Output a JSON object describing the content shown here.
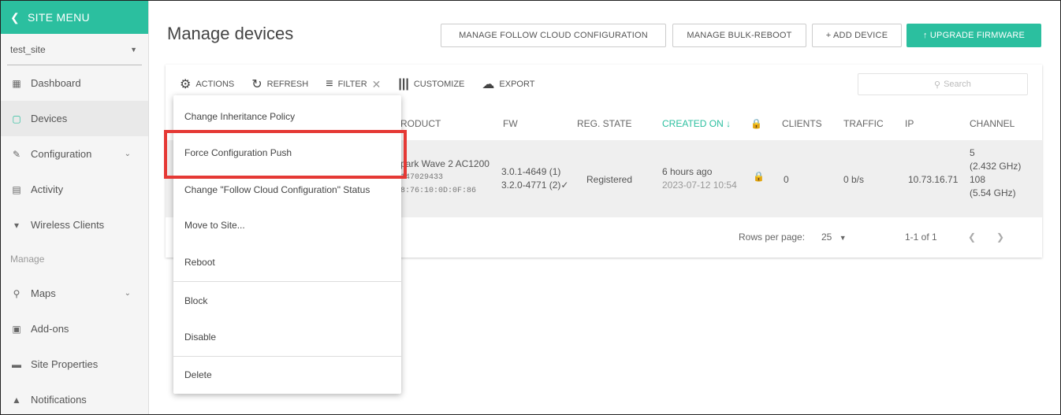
{
  "sidebar": {
    "header": "SITE MENU",
    "site": "test_site",
    "items": [
      {
        "label": "Dashboard",
        "icon": "dashboard-icon",
        "glyph": "▦"
      },
      {
        "label": "Devices",
        "icon": "devices-icon",
        "glyph": "▢"
      },
      {
        "label": "Configuration",
        "icon": "wrench-icon",
        "glyph": "✎"
      },
      {
        "label": "Activity",
        "icon": "activity-icon",
        "glyph": "▤"
      },
      {
        "label": "Wireless Clients",
        "icon": "wifi-icon",
        "glyph": "▾"
      }
    ],
    "section": "Manage",
    "manage_items": [
      {
        "label": "Maps",
        "icon": "map-pin-icon",
        "glyph": "⚲"
      },
      {
        "label": "Add-ons",
        "icon": "addons-icon",
        "glyph": "▣"
      },
      {
        "label": "Site Properties",
        "icon": "properties-icon",
        "glyph": "▬"
      },
      {
        "label": "Notifications",
        "icon": "bell-icon",
        "glyph": "▲"
      }
    ]
  },
  "header": {
    "title": "Manage devices",
    "btn_follow": "MANAGE FOLLOW CLOUD CONFIGURATION",
    "btn_bulk": "MANAGE BULK-REBOOT",
    "btn_add": "+ ADD DEVICE",
    "btn_upgrade": "↑ UPGRADE FIRMWARE"
  },
  "toolbar": {
    "actions": "ACTIONS",
    "refresh": "REFRESH",
    "filter": "FILTER",
    "customize": "CUSTOMIZE",
    "export": "EXPORT",
    "search_placeholder": "Search"
  },
  "table": {
    "columns": [
      "RODUCT",
      "FW",
      "REG. STATE",
      "CREATED ON ↓",
      "CLIENTS",
      "TRAFFIC",
      "IP",
      "CHANNEL"
    ],
    "row": {
      "product": "park Wave 2 AC1200",
      "serial": "147029433",
      "mac": "8:76:10:0D:0F:86",
      "fw1": "3.0.1-4649 (1)",
      "fw2": "3.2.0-4771 (2)✓",
      "reg_state": "Registered",
      "created": "6 hours ago",
      "created_ts": "2023-07-12 10:54",
      "clients": "0",
      "traffic": "0 b/s",
      "ip": "10.73.16.71",
      "ch1": "5",
      "ch1_freq": "(2.432 GHz)",
      "ch2": "108",
      "ch2_freq": "(5.54 GHz)"
    },
    "rows_per_page_label": "Rows per page:",
    "rows_per_page": "25",
    "range": "1-1 of 1"
  },
  "actions_menu": [
    "Change Inheritance Policy",
    "Force Configuration Push",
    "Change \"Follow Cloud Configuration\" Status",
    "Move to Site...",
    "Reboot",
    "Block",
    "Disable",
    "Delete"
  ],
  "colors": {
    "accent": "#2bbf9f",
    "highlight": "#e53935"
  }
}
